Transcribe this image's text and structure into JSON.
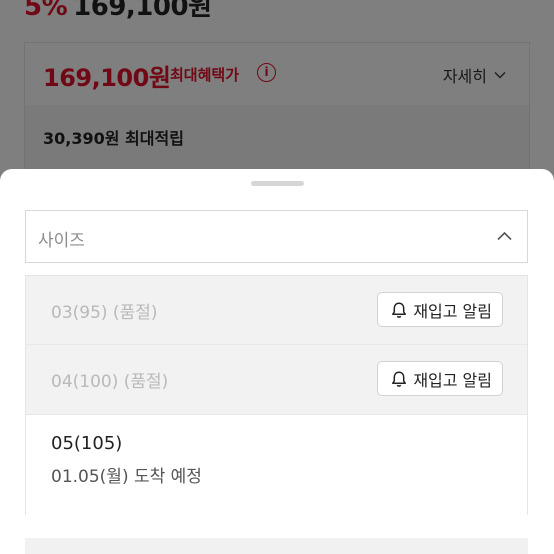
{
  "background_page": {
    "top_price_percent": "5%",
    "top_price": "169,100원",
    "benefit_price": "169,100원",
    "benefit_label": "최대혜택가",
    "info_icon": "info-circle-icon",
    "detail_link": "자세히",
    "points_text": "30,390원 최대적립"
  },
  "sheet": {
    "select_label": "사이즈",
    "options": [
      {
        "text": "03(95) (품절)",
        "button": "재입고 알림",
        "status": "soldout"
      },
      {
        "text": "04(100) (품절)",
        "button": "재입고 알림",
        "status": "soldout"
      },
      {
        "name": "05(105)",
        "arrival": "01.05(월) 도착 예정",
        "status": "available"
      }
    ]
  },
  "colors": {
    "accent": "#e0102a",
    "text": "#222222",
    "muted": "#b9b9b9",
    "soldout_bg": "#f2f2f2"
  }
}
